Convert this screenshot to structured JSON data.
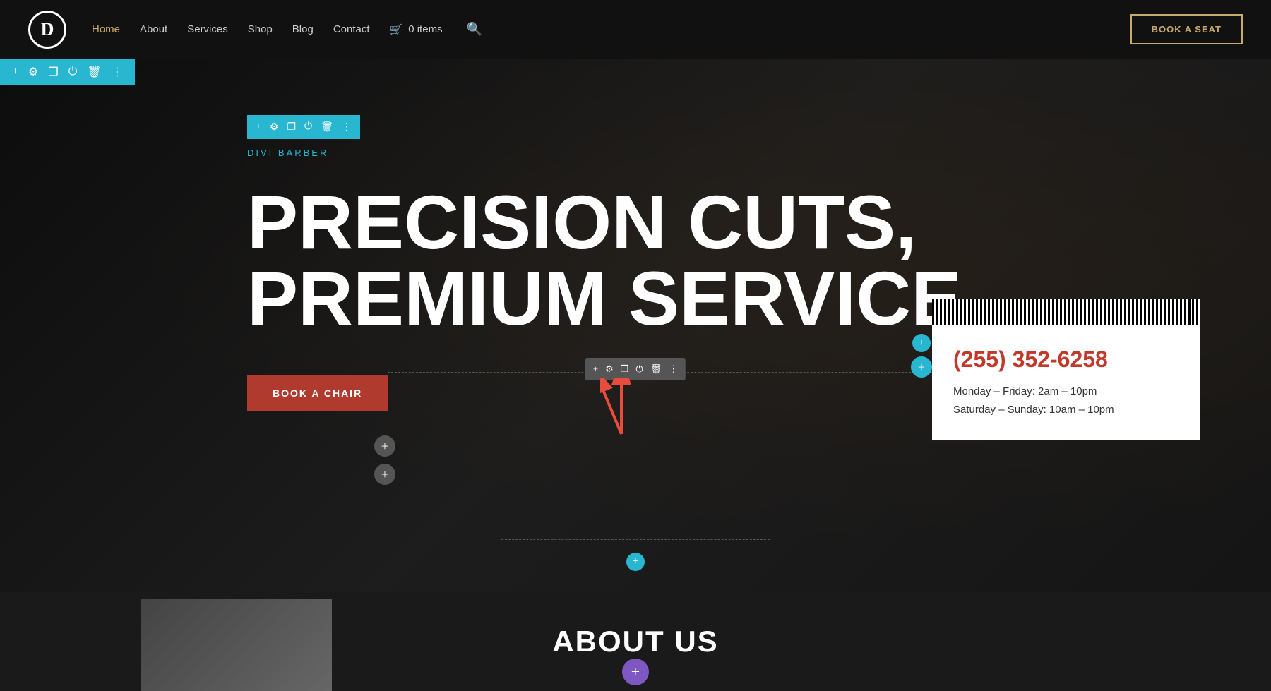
{
  "nav": {
    "logo_letter": "D",
    "links": [
      {
        "label": "Home",
        "active": true
      },
      {
        "label": "About",
        "active": false
      },
      {
        "label": "Services",
        "active": false
      },
      {
        "label": "Shop",
        "active": false
      },
      {
        "label": "Blog",
        "active": false
      },
      {
        "label": "Contact",
        "active": false
      }
    ],
    "cart_label": "0 items",
    "book_btn": "BOOK A SEAT"
  },
  "builder_toolbar": {
    "icons": [
      "+",
      "⚙",
      "❐",
      "⏻",
      "🗑",
      "⋮"
    ]
  },
  "module_toolbar": {
    "icons": [
      "+",
      "⚙",
      "❐",
      "⏻",
      "🗑",
      "⋮"
    ]
  },
  "floating_toolbar": {
    "icons": [
      "+",
      "⚙",
      "❐",
      "⏻",
      "🗑",
      "⋮"
    ]
  },
  "hero": {
    "eyebrow": "DIVI BARBER",
    "title_line1": "PRECISION CUTS,",
    "title_line2": "PREMIUM SERVICE",
    "book_btn": "BOOK A CHAIR",
    "phone": "(255) 352-6258",
    "hours_line1": "Monday – Friday: 2am – 10pm",
    "hours_line2": "Saturday – Sunday: 10am – 10pm"
  },
  "about": {
    "title": "ABOUT US"
  }
}
